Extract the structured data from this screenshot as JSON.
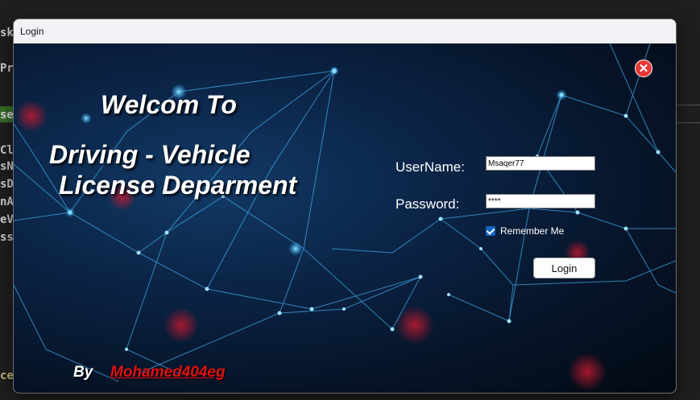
{
  "ide_background": {
    "fragments": [
      "sk",
      "Pr",
      "se",
      "Cl",
      "sN",
      "sD",
      "nA",
      "eV",
      "ss",
      "ce"
    ]
  },
  "window": {
    "title": "Login",
    "welcome": "Welcom To",
    "department_line1": "Driving - Vehicle",
    "department_line2": "License Deparment",
    "username_label": "UserName:",
    "username_value": "Msaqer77",
    "password_label": "Password:",
    "password_value": "****",
    "remember_label": "Remember Me",
    "remember_checked": true,
    "login_button": "Login",
    "close_icon": "close-icon",
    "by_label": "By",
    "author": "Mohamed404eg"
  },
  "colors": {
    "close_button": "#e53935",
    "author_text": "#e01010",
    "checkbox": "#1565c0"
  }
}
